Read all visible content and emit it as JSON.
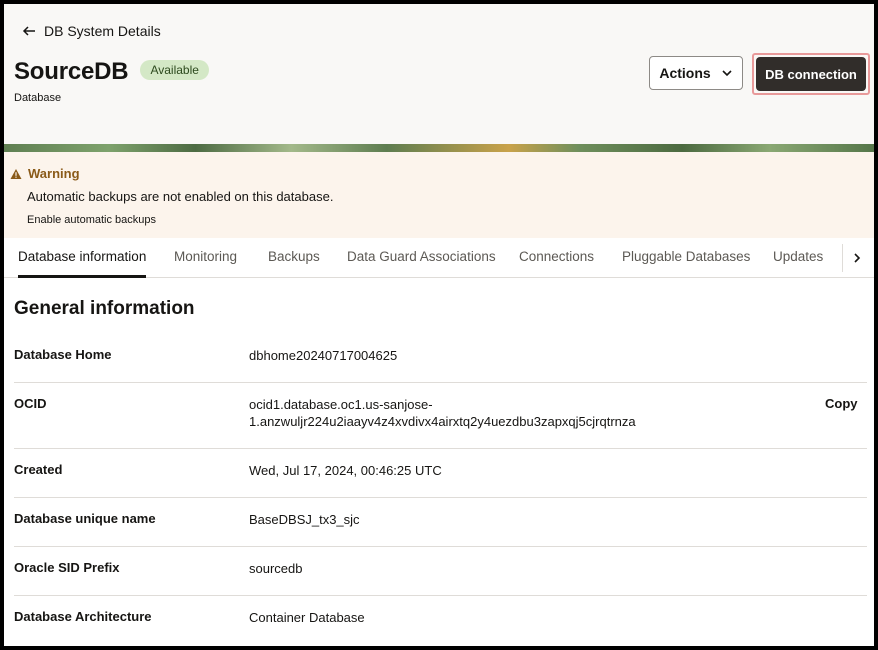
{
  "header": {
    "back_label": "DB System Details",
    "title": "SourceDB",
    "status_badge": "Available",
    "subtitle": "Database",
    "actions_label": "Actions",
    "db_connection_label": "DB connection"
  },
  "warning": {
    "title": "Warning",
    "message": "Automatic backups are not enabled on this database.",
    "link": "Enable automatic backups"
  },
  "tabs": [
    {
      "label": "Database information",
      "active": true
    },
    {
      "label": "Monitoring"
    },
    {
      "label": "Backups"
    },
    {
      "label": "Data Guard Associations"
    },
    {
      "label": "Connections"
    },
    {
      "label": "Pluggable Databases"
    },
    {
      "label": "Updates"
    }
  ],
  "general_info": {
    "title": "General information",
    "copy_label": "Copy",
    "rows": [
      {
        "label": "Database Home",
        "value": "dbhome20240717004625"
      },
      {
        "label": "OCID",
        "value_line1": "ocid1.database.oc1.us-sanjose-",
        "value_line2": "1.anzwuljr224u2iaayv4z4xvdivx4airxtq2y4uezdbu3zapxqj5cjrqtrnza"
      },
      {
        "label": "Created",
        "value": "Wed, Jul 17, 2024, 00:46:25 UTC"
      },
      {
        "label": "Database unique name",
        "value": "BaseDBSJ_tx3_sjc"
      },
      {
        "label": "Oracle SID Prefix",
        "value": "sourcedb"
      },
      {
        "label": "Database Architecture",
        "value": "Container Database"
      }
    ]
  },
  "colors": {
    "primary_button": "#312d2a",
    "badge_bg": "#d4e8c6",
    "warning_bg": "#fcf4ec",
    "warning_text": "#8a5a18",
    "focus_outline": "#e89a9a"
  }
}
